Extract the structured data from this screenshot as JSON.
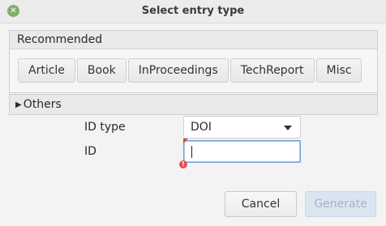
{
  "window": {
    "title": "Select entry type",
    "close_icon": "close-icon",
    "close_color": "#7fb069"
  },
  "recommended": {
    "header": "Recommended",
    "types": [
      "Article",
      "Book",
      "InProceedings",
      "TechReport",
      "Misc"
    ]
  },
  "others": {
    "label": "Others",
    "expand_icon": "triangle-right-icon"
  },
  "form": {
    "id_type_label": "ID type",
    "id_type_value": "DOI",
    "id_label": "ID",
    "id_value": "",
    "error_color": "#e23b3b"
  },
  "buttons": {
    "cancel": "Cancel",
    "generate": "Generate"
  },
  "colors": {
    "focus_border": "#6f9ed7",
    "disabled_button_bg": "#dbe5f1"
  }
}
